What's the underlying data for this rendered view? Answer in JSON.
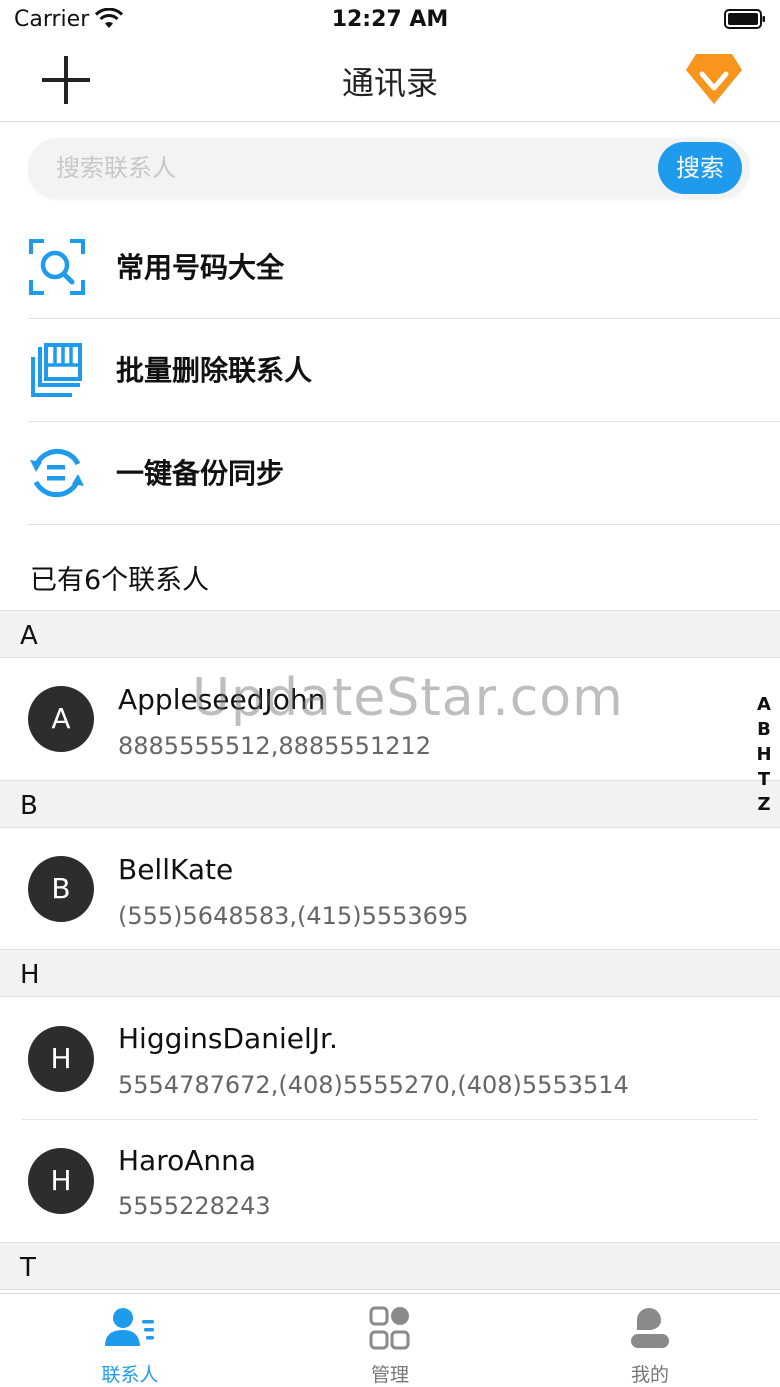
{
  "status_bar": {
    "carrier": "Carrier",
    "time": "12:27 AM"
  },
  "nav": {
    "title": "通讯录"
  },
  "search": {
    "placeholder": "搜索联系人",
    "button_label": "搜索"
  },
  "menu": [
    {
      "label": "常用号码大全",
      "icon": "scan-search-icon"
    },
    {
      "label": "批量删除联系人",
      "icon": "batch-delete-icon"
    },
    {
      "label": "一键备份同步",
      "icon": "backup-sync-icon"
    }
  ],
  "contact_count_label": "已有6个联系人",
  "sections": [
    {
      "letter": "A",
      "contacts": [
        {
          "initial": "A",
          "name": "AppleseedJohn",
          "phones": "8885555512,8885551212"
        }
      ]
    },
    {
      "letter": "B",
      "contacts": [
        {
          "initial": "B",
          "name": "BellKate",
          "phones": "(555)5648583,(415)5553695"
        }
      ]
    },
    {
      "letter": "H",
      "contacts": [
        {
          "initial": "H",
          "name": "HigginsDanielJr.",
          "phones": "5554787672,(408)5555270,(408)5553514"
        },
        {
          "initial": "H",
          "name": "HaroAnna",
          "phones": "5555228243"
        }
      ]
    },
    {
      "letter": "T",
      "contacts": []
    }
  ],
  "index_letters": [
    "A",
    "B",
    "H",
    "T",
    "Z"
  ],
  "watermark": "UpdateStar.com",
  "tabs": [
    {
      "label": "联系人",
      "active": true,
      "icon": "contacts-icon"
    },
    {
      "label": "管理",
      "active": false,
      "icon": "manage-grid-icon"
    },
    {
      "label": "我的",
      "active": false,
      "icon": "profile-icon"
    }
  ],
  "colors": {
    "accent": "#1e9bec",
    "vip": "#f7951d",
    "avatar": "#2d2d2d"
  }
}
